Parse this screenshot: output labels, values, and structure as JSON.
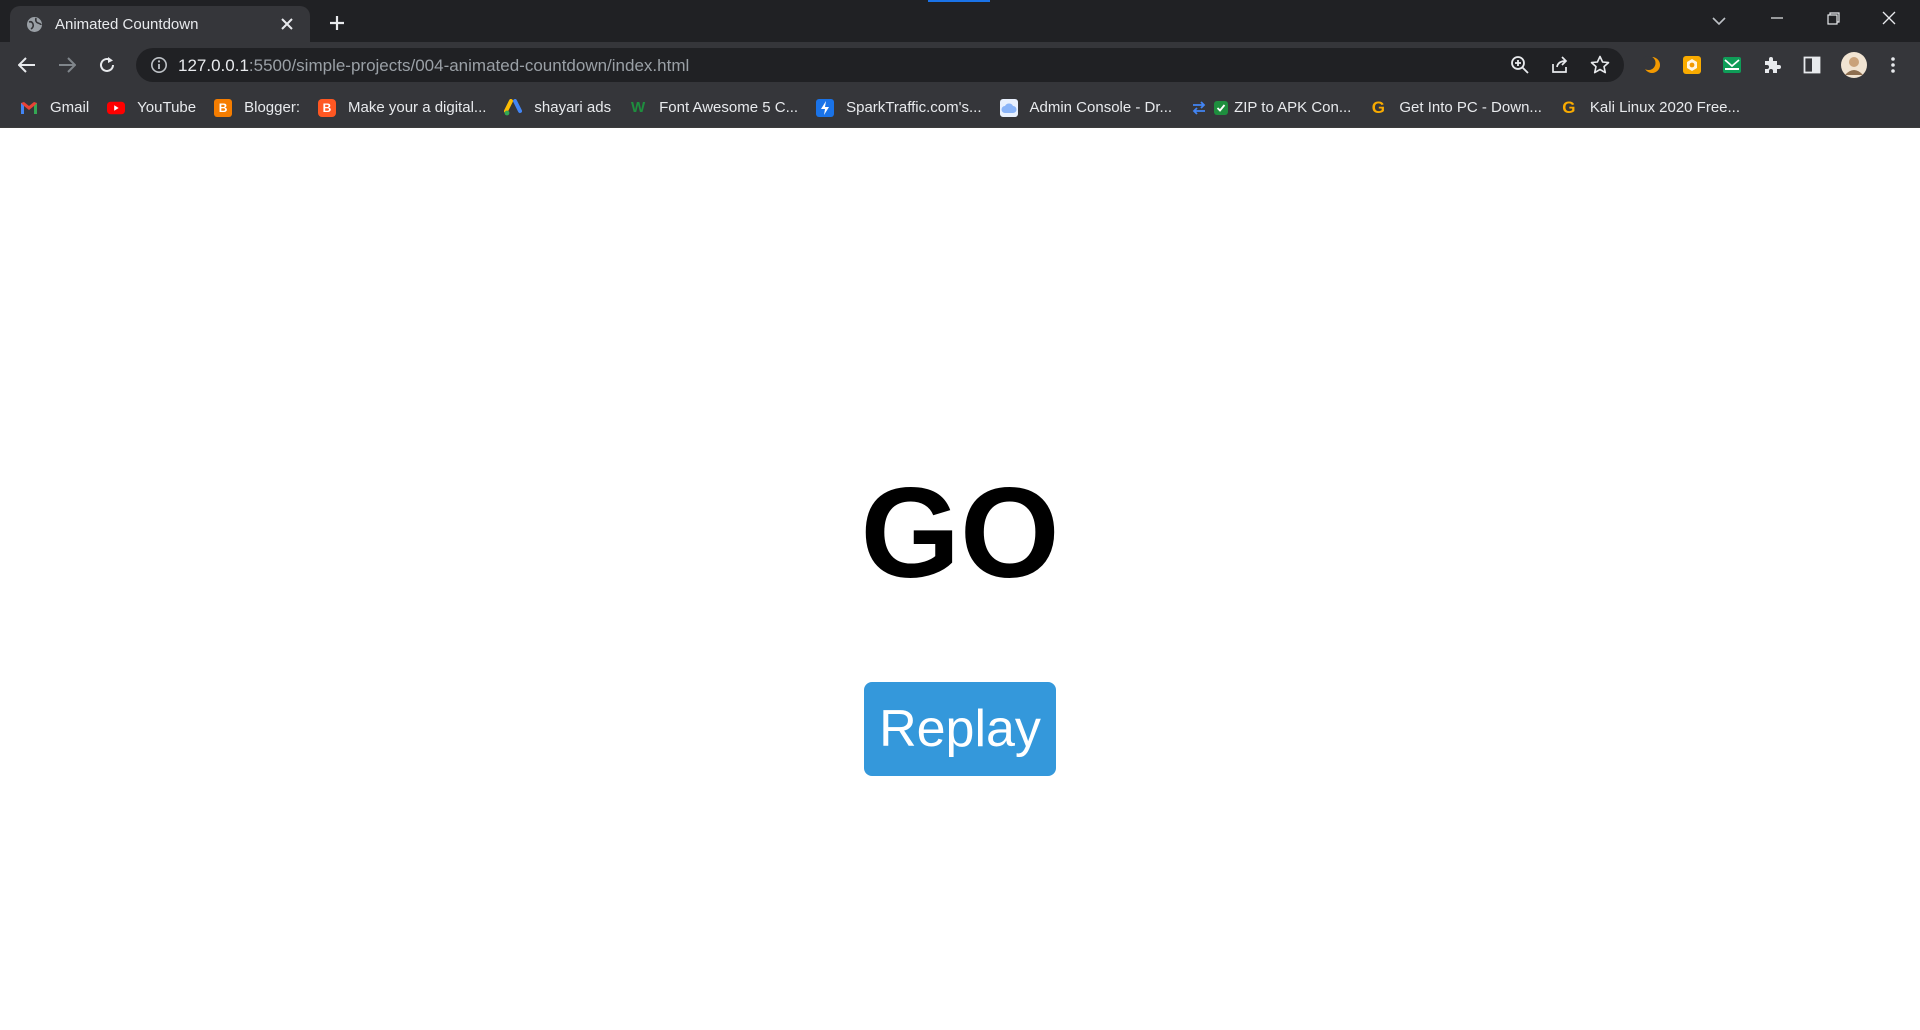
{
  "browser": {
    "tab": {
      "title": "Animated Countdown",
      "active": true
    },
    "address_bar": {
      "host": "127.0.0.1",
      "path": ":5500/simple-projects/004-animated-countdown/index.html"
    },
    "bookmarks": [
      {
        "label": "Gmail",
        "icon": "gmail-icon",
        "color": "#ea4335"
      },
      {
        "label": "YouTube",
        "icon": "youtube-icon",
        "color": "#ff0000"
      },
      {
        "label": "Blogger:",
        "icon": "blogger-icon",
        "color": "#f57d00"
      },
      {
        "label": "Make your a digital...",
        "icon": "blogger-icon",
        "color": "#f57d00"
      },
      {
        "label": "shayari ads",
        "icon": "google-ads-icon",
        "color": "#fbbc04"
      },
      {
        "label": "Font Awesome 5 C...",
        "icon": "wix-icon",
        "color": "#1e8e3e"
      },
      {
        "label": "SparkTraffic.com's...",
        "icon": "sparktraffic-icon",
        "color": "#1a73e8"
      },
      {
        "label": "Admin Console - Dr...",
        "icon": "cloud-icon",
        "color": "#8ab4f8"
      },
      {
        "label": "ZIP to APK Con...",
        "icon": "convert-icon",
        "color": "#4285f4"
      },
      {
        "label": "Get Into PC - Down...",
        "icon": "g-icon",
        "color": "#f9ab00"
      },
      {
        "label": "Kali Linux 2020 Free...",
        "icon": "g-icon",
        "color": "#f9ab00"
      }
    ],
    "extensions": [
      "crescent-extension-icon",
      "orange-extension-icon",
      "mail-extension-icon",
      "puzzle-icon",
      "side-panel-icon",
      "profile-avatar"
    ]
  },
  "page": {
    "countdown_text": "GO",
    "replay_label": "Replay",
    "accent_color": "#3498db"
  }
}
